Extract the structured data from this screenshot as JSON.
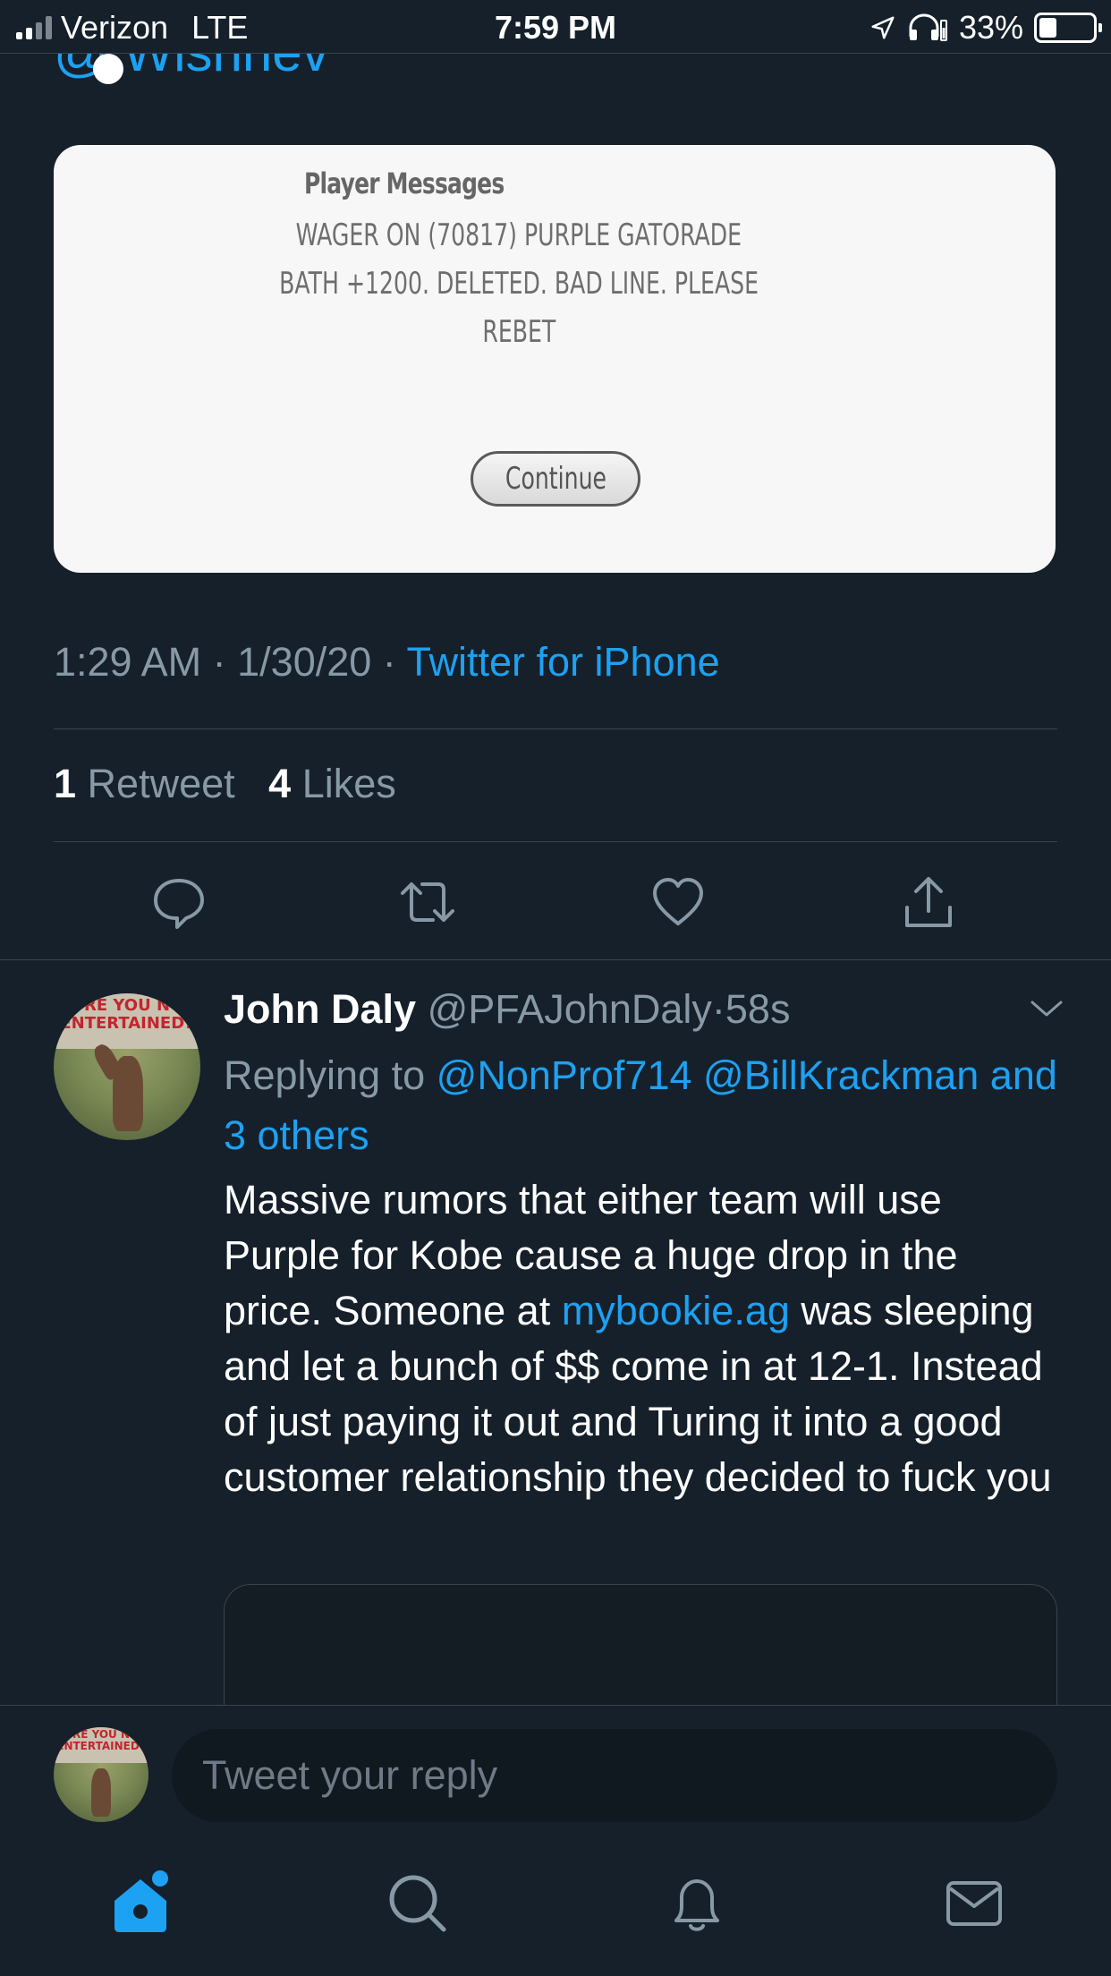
{
  "status_bar": {
    "carrier": "Verizon",
    "network": "LTE",
    "time": "7:59 PM",
    "battery_percent": "33%",
    "battery_level": 0.33
  },
  "previous_tweet": {
    "cut_handle_text": "@ Wishnev",
    "media": {
      "title": "Player Messages",
      "message_lines": [
        "WAGER ON (70817) PURPLE GATORADE",
        "BATH +1200. DELETED. BAD LINE. PLEASE",
        "REBET"
      ],
      "button_label": "Continue"
    },
    "time": "1:29 AM",
    "date": "1/30/20",
    "separator": "·",
    "source": "Twitter for iPhone",
    "retweet_count": "1",
    "retweet_label": "Retweet",
    "like_count": "4",
    "like_label": "Likes",
    "actions": [
      "reply-icon",
      "retweet-icon",
      "like-icon",
      "share-icon"
    ]
  },
  "reply": {
    "avatar_caption": "RE YOU N ENTERTAINED?",
    "name": "John Daly",
    "handle": "@PFAJohnDaly",
    "separator": "·",
    "age": "58s",
    "replying_prefix": "Replying to",
    "mention_1": "@NonProf714",
    "mention_2": "@BillKrackman",
    "mention_others": "and 3 others",
    "text_part_1": "Massive rumors that either team will use Purple for Kobe cause a huge drop in the price.  Someone at",
    "text_link": "mybookie.ag",
    "text_part_2": "was sleeping and let a bunch of $$ come in at 12-1.  Instead of just paying it out and Turing it into a good customer relationship they decided to fuck you"
  },
  "composer": {
    "placeholder": "Tweet your reply",
    "avatar_caption": "RE YOU N ENTERTAINED?"
  },
  "tab_bar": [
    "home-icon",
    "search-icon",
    "notifications-icon",
    "messages-icon"
  ],
  "colors": {
    "background": "#15202b",
    "accent": "#1da1f2",
    "secondary_text": "#8899a6",
    "divider": "#38444d"
  }
}
